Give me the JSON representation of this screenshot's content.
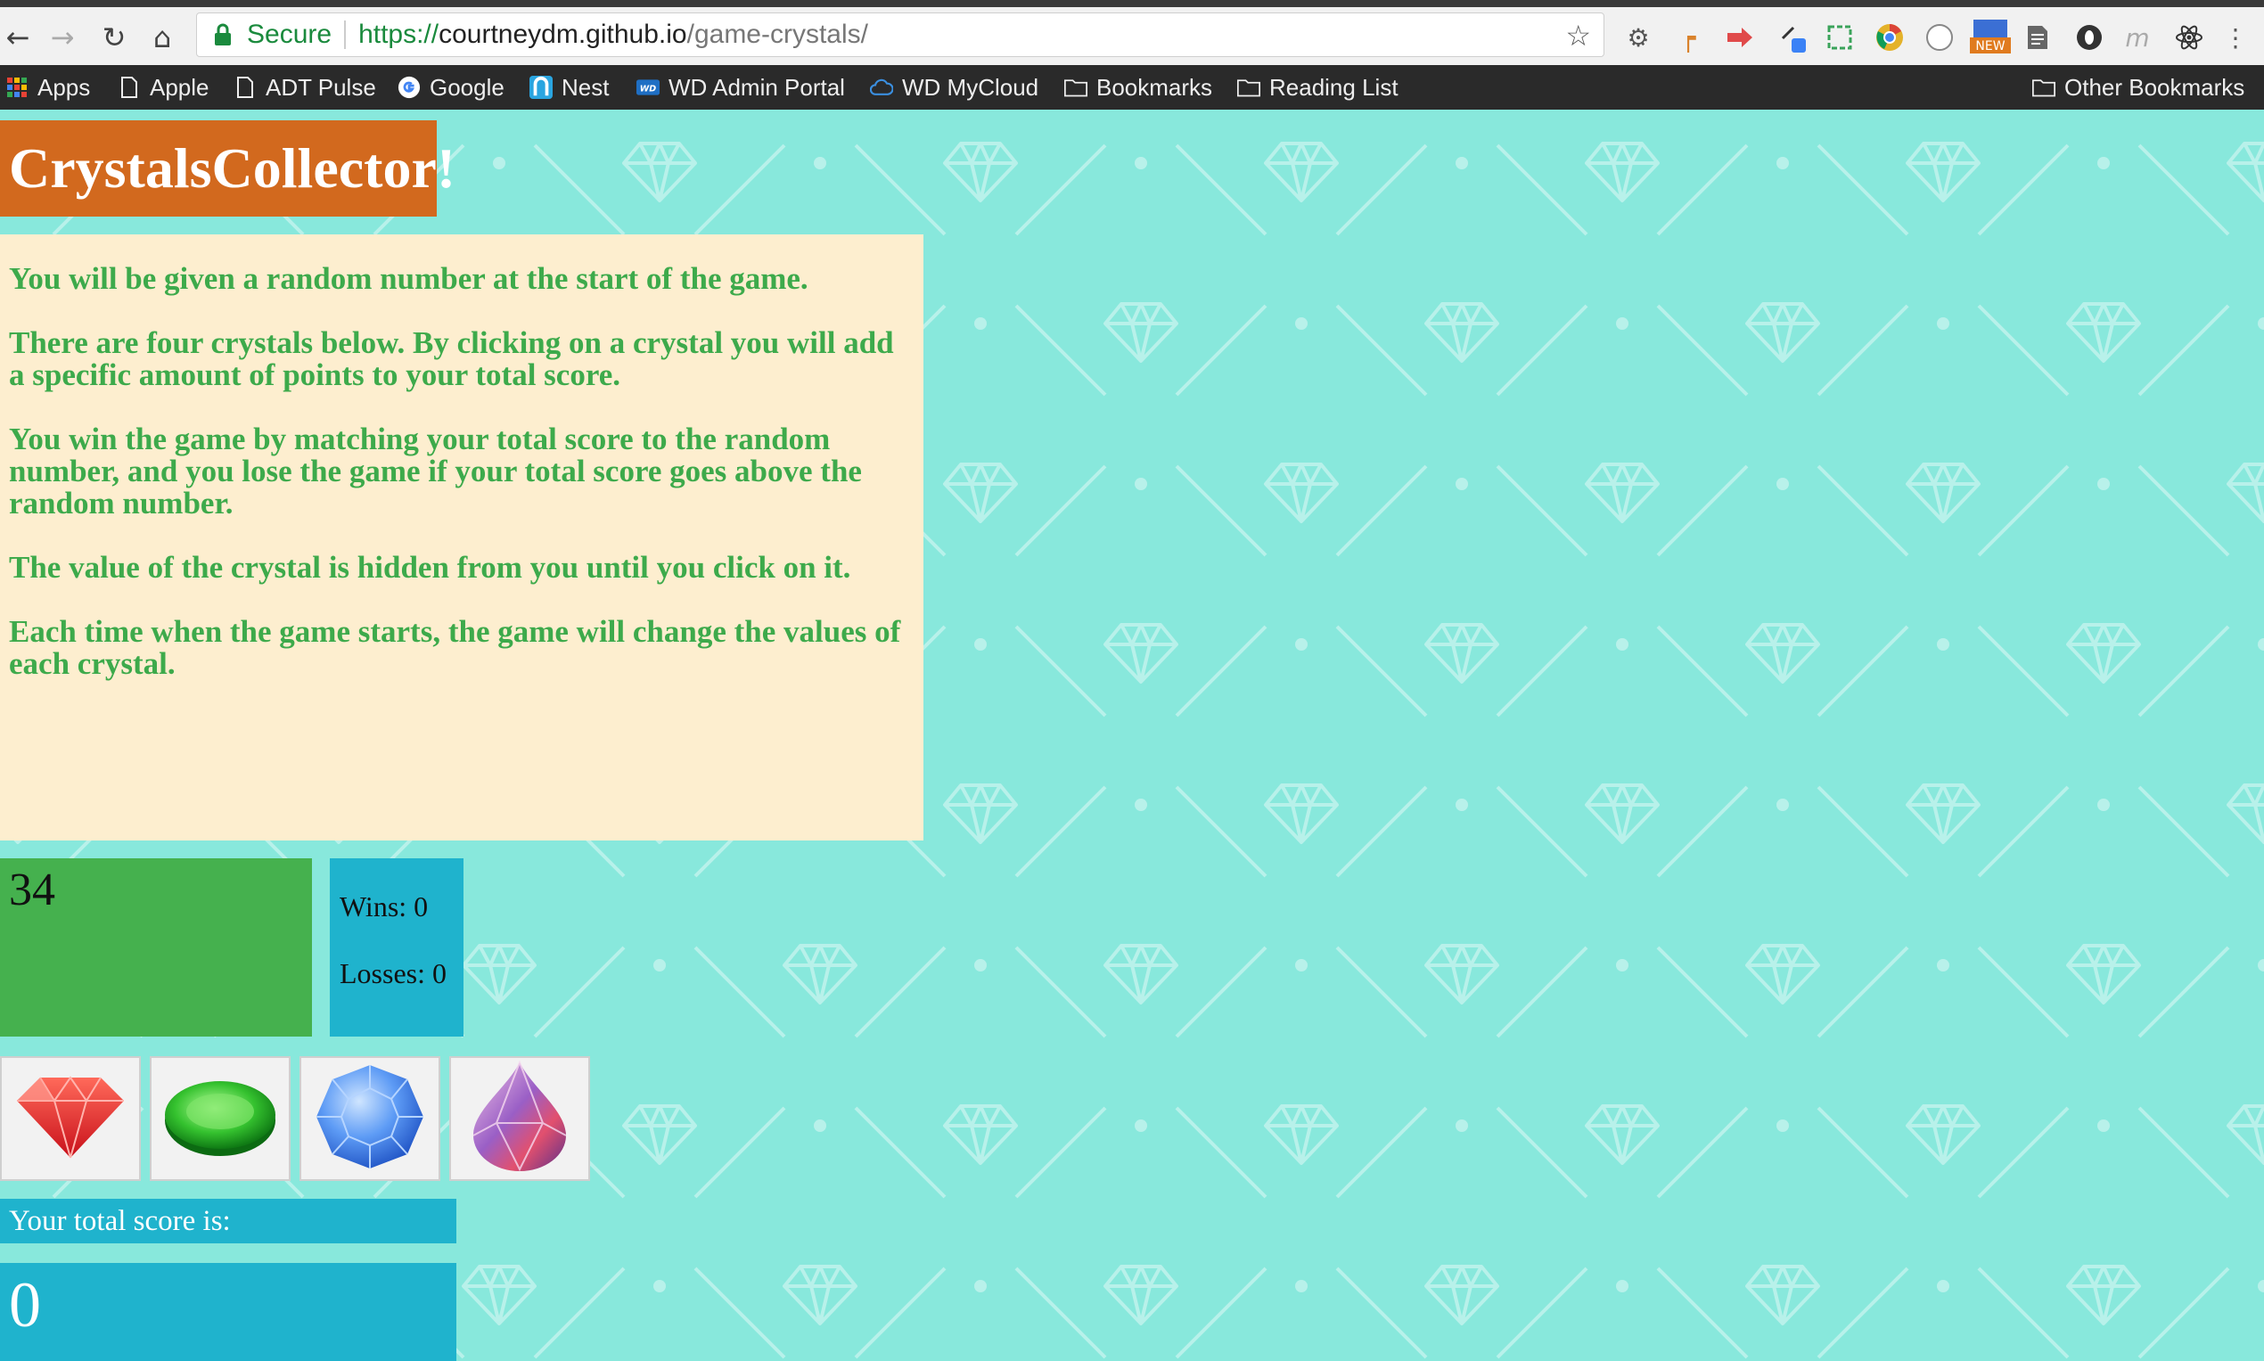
{
  "browser": {
    "secure_label": "Secure",
    "url_scheme": "https://",
    "url_host": "courtneydm.github.io",
    "url_path": "/game-crystals/",
    "extensions": [
      "gear-icon",
      "pin-icon",
      "red-arrow-icon",
      "pen-icon",
      "screenshot-icon",
      "chrome-logo-icon",
      "circle-icon",
      "new-badge-icon",
      "document-icon",
      "o-icon",
      "m-icon",
      "atom-icon",
      "more-icon"
    ],
    "new_badge": "NEW",
    "ext_m": "m"
  },
  "bookmarks": {
    "items": [
      "Apps",
      "Apple",
      "ADT Pulse",
      "Google",
      "Nest",
      "WD Admin Portal",
      "WD MyCloud",
      "Bookmarks",
      "Reading List"
    ],
    "other": "Other Bookmarks",
    "wd_badge": "WD"
  },
  "game": {
    "title": "CrystalsCollector!",
    "instructions": [
      "You will be given a random number at the start of the game.",
      "There are four crystals below. By clicking on a crystal you will add a specific amount of points to your total score.",
      "You win the game by matching your total score to the random number, and you lose the game if your total score goes above the random number.",
      "The value of the crystal is hidden from you until you click on it.",
      "Each time when the game starts, the game will change the values of each crystal."
    ],
    "target_number": "34",
    "wins": "Wins: 0",
    "losses": "Losses: 0",
    "crystals": [
      "red-crystal-icon",
      "green-crystal-icon",
      "blue-crystal-icon",
      "purple-crystal-icon"
    ],
    "score_label": "Your total score is:",
    "score_value": "0"
  },
  "colors": {
    "background": "#88e8dc",
    "title_bg": "#d2691e",
    "instructions_bg": "#fdeecf",
    "instructions_text": "#3daa4b",
    "target_bg": "#45b14e",
    "panel_bg": "#1fb3cd"
  }
}
